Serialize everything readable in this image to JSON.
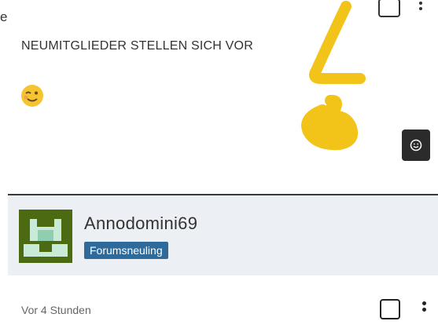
{
  "stray_char": "e",
  "post": {
    "heading": "NEUMITGLIEDER STELLEN SICH VOR",
    "emoji_icon": "wink-emoji-icon",
    "emoji_picker_icon": "smiley-icon"
  },
  "author": {
    "username": "Annodomini69",
    "rank": "Forumsneuling"
  },
  "footer": {
    "timestamp": "Vor 4 Stunden"
  },
  "colors": {
    "badge": "#2f6b9a",
    "author_bar": "#eceff3",
    "avatar": "#4c6a12",
    "scribble": "#f2c318"
  }
}
